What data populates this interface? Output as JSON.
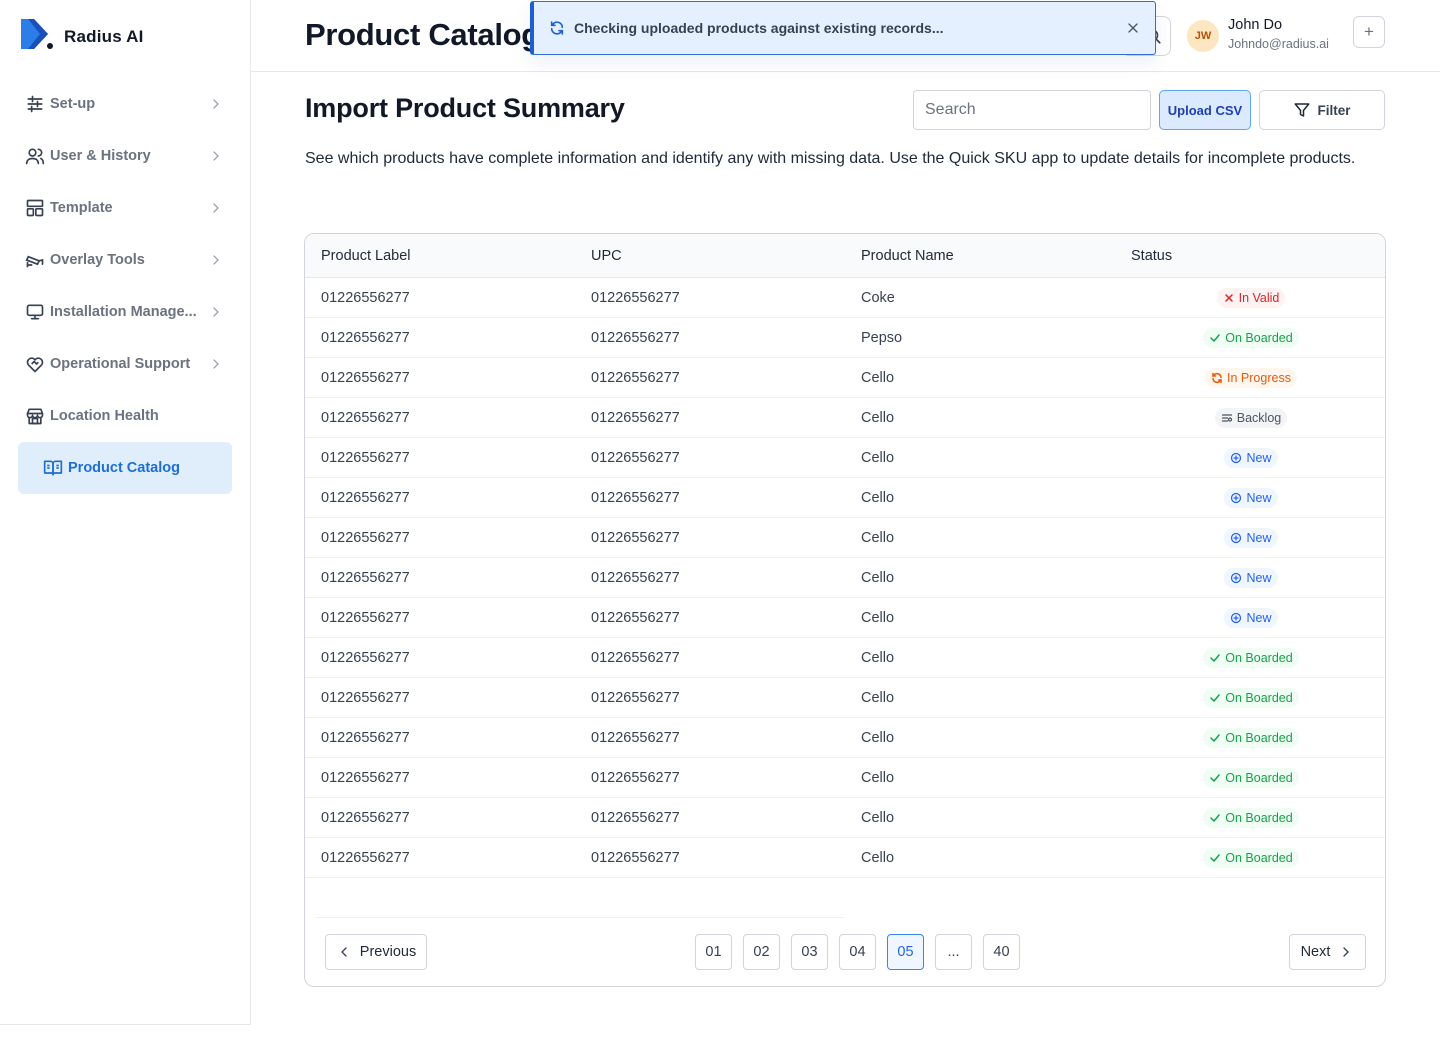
{
  "brand": {
    "name": "Radius AI"
  },
  "sidebar": {
    "items": [
      {
        "label": "Set-up",
        "icon": "sliders-icon"
      },
      {
        "label": "User & History",
        "icon": "users-icon"
      },
      {
        "label": "Template",
        "icon": "layout-icon"
      },
      {
        "label": "Overlay Tools",
        "icon": "cctv-icon"
      },
      {
        "label": "Installation Manage...",
        "icon": "monitor-icon"
      },
      {
        "label": "Operational Support",
        "icon": "heart-handshake-icon"
      },
      {
        "label": "Location Health",
        "icon": "store-icon"
      },
      {
        "label": "Product Catalog",
        "icon": "book-open-icon",
        "active": true
      }
    ]
  },
  "header": {
    "title": "Product Catalog",
    "user": {
      "initials": "JW",
      "name": "John Do",
      "email": "Johndo@radius.ai"
    },
    "add_label": "+"
  },
  "toast": {
    "message": "Checking uploaded products against existing records..."
  },
  "main": {
    "title": "Import Product Summary",
    "search_placeholder": "Search",
    "upload_label": "Upload CSV",
    "filter_label": "Filter",
    "description": "See which products have complete information and identify any with missing data. Use the Quick SKU app to update details for incomplete products."
  },
  "table": {
    "columns": [
      "Product Label",
      "UPC",
      "Product Name",
      "Status"
    ],
    "rows": [
      {
        "label": "01226556277",
        "upc": "01226556277",
        "name": "Coke",
        "status": "In Valid",
        "kind": "invalid"
      },
      {
        "label": "01226556277",
        "upc": "01226556277",
        "name": "Pepso",
        "status": "On Boarded",
        "kind": "onboarded"
      },
      {
        "label": "01226556277",
        "upc": "01226556277",
        "name": "Cello",
        "status": "In Progress",
        "kind": "progress"
      },
      {
        "label": "01226556277",
        "upc": "01226556277",
        "name": "Cello",
        "status": "Backlog",
        "kind": "backlog"
      },
      {
        "label": "01226556277",
        "upc": "01226556277",
        "name": "Cello",
        "status": "New",
        "kind": "new"
      },
      {
        "label": "01226556277",
        "upc": "01226556277",
        "name": "Cello",
        "status": "New",
        "kind": "new"
      },
      {
        "label": "01226556277",
        "upc": "01226556277",
        "name": "Cello",
        "status": "New",
        "kind": "new"
      },
      {
        "label": "01226556277",
        "upc": "01226556277",
        "name": "Cello",
        "status": "New",
        "kind": "new"
      },
      {
        "label": "01226556277",
        "upc": "01226556277",
        "name": "Cello",
        "status": "New",
        "kind": "new"
      },
      {
        "label": "01226556277",
        "upc": "01226556277",
        "name": "Cello",
        "status": "On Boarded",
        "kind": "onboarded"
      },
      {
        "label": "01226556277",
        "upc": "01226556277",
        "name": "Cello",
        "status": "On Boarded",
        "kind": "onboarded"
      },
      {
        "label": "01226556277",
        "upc": "01226556277",
        "name": "Cello",
        "status": "On Boarded",
        "kind": "onboarded"
      },
      {
        "label": "01226556277",
        "upc": "01226556277",
        "name": "Cello",
        "status": "On Boarded",
        "kind": "onboarded"
      },
      {
        "label": "01226556277",
        "upc": "01226556277",
        "name": "Cello",
        "status": "On Boarded",
        "kind": "onboarded"
      },
      {
        "label": "01226556277",
        "upc": "01226556277",
        "name": "Cello",
        "status": "On Boarded",
        "kind": "onboarded"
      }
    ]
  },
  "pagination": {
    "previous_label": "Previous",
    "next_label": "Next",
    "pages": [
      "01",
      "02",
      "03",
      "04",
      "05",
      "...",
      "40"
    ],
    "current": "05"
  },
  "colors": {
    "accent": "#1d6fd1",
    "invalid": "#dc2626",
    "onboarded": "#16a34a",
    "progress": "#ea580c",
    "new": "#2563eb"
  }
}
